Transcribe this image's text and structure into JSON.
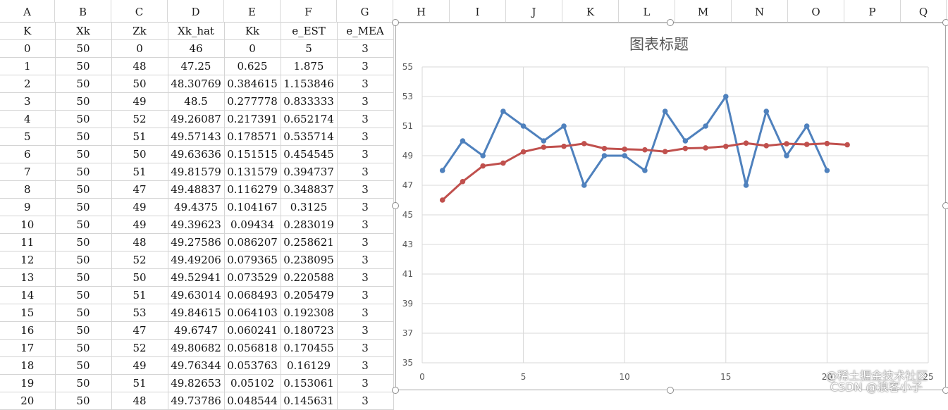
{
  "columns": [
    "A",
    "B",
    "C",
    "D",
    "E",
    "F",
    "G",
    "H",
    "I",
    "J",
    "K",
    "L",
    "M",
    "N",
    "O",
    "P",
    "Q"
  ],
  "table": {
    "headers": [
      "K",
      "Xk",
      "Zk",
      "Xk_hat",
      "Kk",
      "e_EST",
      "e_MEA"
    ],
    "rows": [
      [
        "0",
        "50",
        "0",
        "46",
        "0",
        "5",
        "3"
      ],
      [
        "1",
        "50",
        "48",
        "47.25",
        "0.625",
        "1.875",
        "3"
      ],
      [
        "2",
        "50",
        "50",
        "48.30769",
        "0.384615",
        "1.153846",
        "3"
      ],
      [
        "3",
        "50",
        "49",
        "48.5",
        "0.277778",
        "0.833333",
        "3"
      ],
      [
        "4",
        "50",
        "52",
        "49.26087",
        "0.217391",
        "0.652174",
        "3"
      ],
      [
        "5",
        "50",
        "51",
        "49.57143",
        "0.178571",
        "0.535714",
        "3"
      ],
      [
        "6",
        "50",
        "50",
        "49.63636",
        "0.151515",
        "0.454545",
        "3"
      ],
      [
        "7",
        "50",
        "51",
        "49.81579",
        "0.131579",
        "0.394737",
        "3"
      ],
      [
        "8",
        "50",
        "47",
        "49.48837",
        "0.116279",
        "0.348837",
        "3"
      ],
      [
        "9",
        "50",
        "49",
        "49.4375",
        "0.104167",
        "0.3125",
        "3"
      ],
      [
        "10",
        "50",
        "49",
        "49.39623",
        "0.09434",
        "0.283019",
        "3"
      ],
      [
        "11",
        "50",
        "48",
        "49.27586",
        "0.086207",
        "0.258621",
        "3"
      ],
      [
        "12",
        "50",
        "52",
        "49.49206",
        "0.079365",
        "0.238095",
        "3"
      ],
      [
        "13",
        "50",
        "50",
        "49.52941",
        "0.073529",
        "0.220588",
        "3"
      ],
      [
        "14",
        "50",
        "51",
        "49.63014",
        "0.068493",
        "0.205479",
        "3"
      ],
      [
        "15",
        "50",
        "53",
        "49.84615",
        "0.064103",
        "0.192308",
        "3"
      ],
      [
        "16",
        "50",
        "47",
        "49.6747",
        "0.060241",
        "0.180723",
        "3"
      ],
      [
        "17",
        "50",
        "52",
        "49.80682",
        "0.056818",
        "0.170455",
        "3"
      ],
      [
        "18",
        "50",
        "49",
        "49.76344",
        "0.053763",
        "0.16129",
        "3"
      ],
      [
        "19",
        "50",
        "51",
        "49.82653",
        "0.05102",
        "0.153061",
        "3"
      ],
      [
        "20",
        "50",
        "48",
        "49.73786",
        "0.048544",
        "0.145631",
        "3"
      ]
    ]
  },
  "chart_data": {
    "type": "line",
    "title": "图表标题",
    "xlabel": "",
    "ylabel": "",
    "xlim": [
      0,
      25
    ],
    "ylim": [
      35,
      55
    ],
    "xticks": [
      0,
      5,
      10,
      15,
      20,
      25
    ],
    "yticks": [
      35,
      37,
      39,
      41,
      43,
      45,
      47,
      49,
      51,
      53,
      55
    ],
    "grid": true,
    "series": [
      {
        "color": "#4f81bd",
        "x": [
          1,
          2,
          3,
          4,
          5,
          6,
          7,
          8,
          9,
          10,
          11,
          12,
          13,
          14,
          15,
          16,
          17,
          18,
          19,
          20
        ],
        "y": [
          48,
          50,
          49,
          52,
          51,
          50,
          51,
          47,
          49,
          49,
          48,
          52,
          50,
          51,
          53,
          47,
          52,
          49,
          51,
          48
        ]
      },
      {
        "color": "#c0504d",
        "x": [
          1,
          2,
          3,
          4,
          5,
          6,
          7,
          8,
          9,
          10,
          11,
          12,
          13,
          14,
          15,
          16,
          17,
          18,
          19,
          20,
          21
        ],
        "y": [
          46,
          47.25,
          48.30769,
          48.5,
          49.26087,
          49.57143,
          49.63636,
          49.81579,
          49.48837,
          49.4375,
          49.39623,
          49.27586,
          49.49206,
          49.52941,
          49.63014,
          49.84615,
          49.6747,
          49.80682,
          49.76344,
          49.82653,
          49.73786
        ]
      }
    ]
  },
  "watermark": {
    "line1": "@稀土掘金技术社区",
    "line2": "CSDN @浪客小子"
  }
}
